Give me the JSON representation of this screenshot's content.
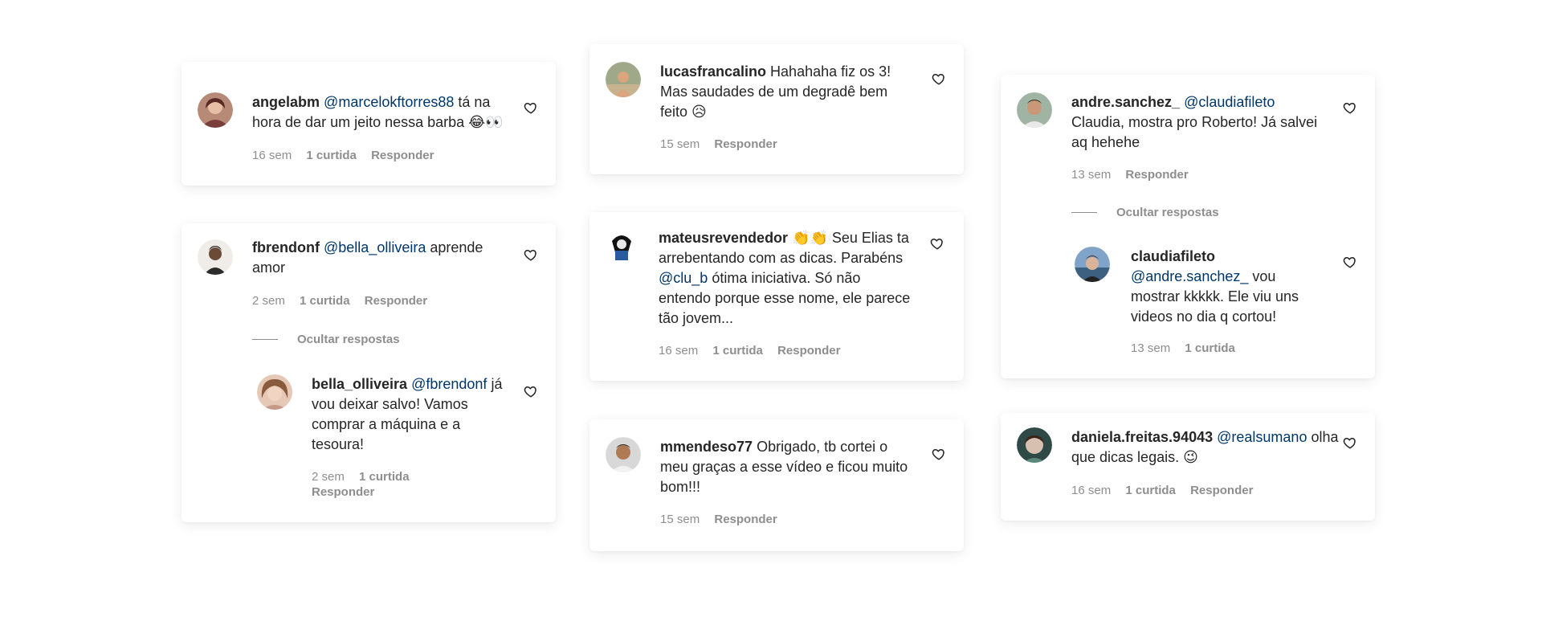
{
  "comments": {
    "c1": {
      "user": "angelabm",
      "mention": "@marcelokftorres88",
      "text": " tá na hora de dar um jeito nessa barba 😂👀",
      "time": "16 sem",
      "likes": "1 curtida",
      "reply": "Responder"
    },
    "c2": {
      "user": "fbrendonf",
      "mention": "@bella_olliveira",
      "text": " aprende amor",
      "time": "2 sem",
      "likes": "1 curtida",
      "reply": "Responder",
      "hide": "Ocultar respostas"
    },
    "c2r": {
      "user": "bella_olliveira",
      "mention": "@fbrendonf",
      "text": " já vou deixar salvo! Vamos comprar a máquina e a tesoura!",
      "time": "2 sem",
      "likes": "1 curtida",
      "reply": "Responder"
    },
    "c3": {
      "user": "lucasfrancalino",
      "text": " Hahahaha fiz os 3! Mas saudades de um degradê bem feito 😥",
      "time": "15 sem",
      "reply": "Responder"
    },
    "c4": {
      "user": "mateusrevendedor",
      "text_a": " 👏👏 Seu Elias ta arrebentando com as dicas. Parabéns ",
      "mention": "@clu_b",
      "text_b": " ótima iniciativa. Só não entendo porque esse nome, ele parece tão jovem...",
      "time": "16 sem",
      "likes": "1 curtida",
      "reply": "Responder"
    },
    "c5": {
      "user": "mmendeso77",
      "text": " Obrigado, tb cortei o meu graças a esse vídeo e ficou muito bom!!!",
      "time": "15 sem",
      "reply": "Responder"
    },
    "c6": {
      "user": "andre.sanchez_",
      "mention": "@claudiafileto",
      "text": " Claudia, mostra pro Roberto! Já salvei aq hehehe",
      "time": "13 sem",
      "reply": "Responder",
      "hide": "Ocultar respostas"
    },
    "c6r": {
      "user": "claudiafileto",
      "mention": "@andre.sanchez_",
      "text": " vou mostrar kkkkk. Ele viu uns videos no dia q cortou!",
      "time": "13 sem",
      "likes": "1 curtida"
    },
    "c7": {
      "user": "daniela.freitas.94043",
      "mention": "@realsumano",
      "text": " olha que dicas legais. 😉",
      "time": "16 sem",
      "likes": "1 curtida",
      "reply": "Responder"
    }
  },
  "icons": {
    "heart": "heart-outline-icon"
  },
  "colors": {
    "mention": "#00376b",
    "meta": "#8e8e8e",
    "text": "#262626"
  }
}
